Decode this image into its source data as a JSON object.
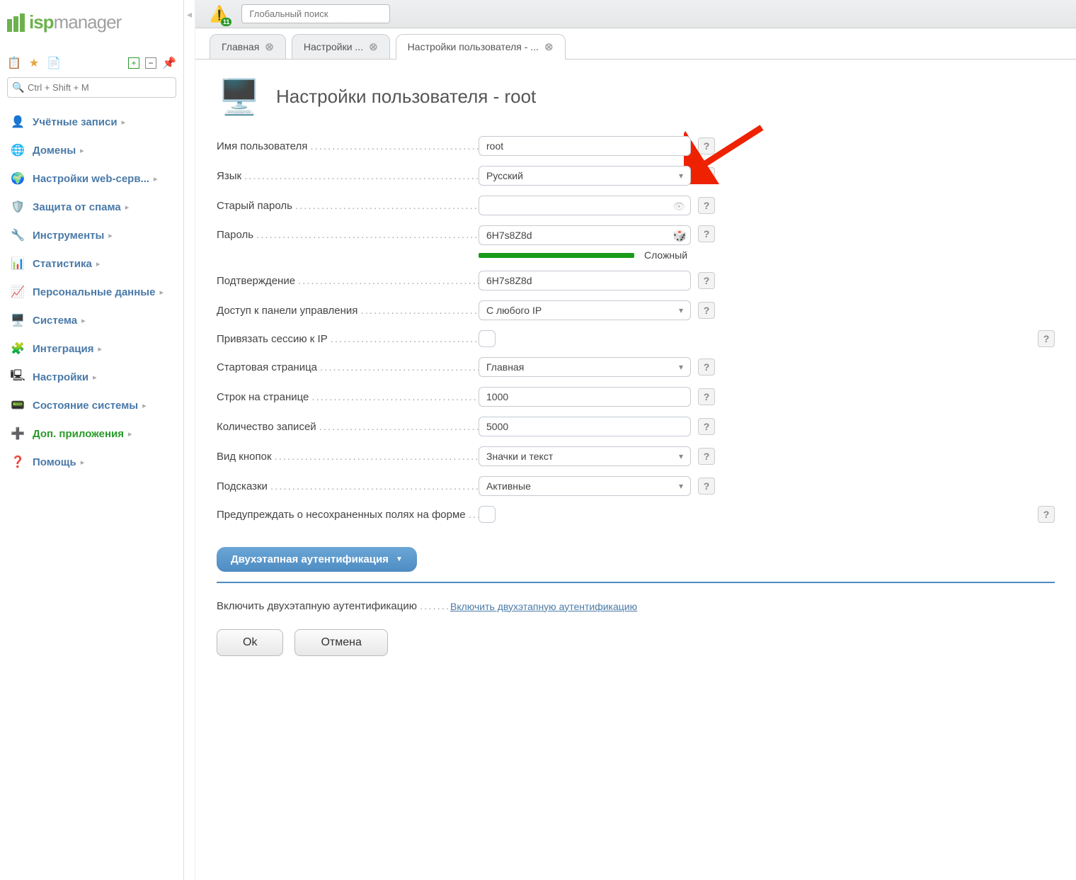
{
  "logo": {
    "prefix": "isp",
    "suffix": "manager"
  },
  "toolbar_icons": [
    "list-icon",
    "star-icon",
    "clipboard-icon",
    "plus-icon",
    "minus-icon",
    "pin-icon"
  ],
  "search": {
    "placeholder": "Ctrl + Shift + M"
  },
  "nav": [
    {
      "icon": "👤",
      "label": "Учётные записи",
      "color": "#4a7aa8"
    },
    {
      "icon": "🌐",
      "label": "Домены",
      "color": "#4a7aa8"
    },
    {
      "icon": "🌍",
      "label": "Настройки web-серв...",
      "color": "#4a7aa8"
    },
    {
      "icon": "🛡️",
      "label": "Защита от спама",
      "color": "#4a7aa8"
    },
    {
      "icon": "🔧",
      "label": "Инструменты",
      "color": "#4a7aa8"
    },
    {
      "icon": "📊",
      "label": "Статистика",
      "color": "#4a7aa8"
    },
    {
      "icon": "📈",
      "label": "Персональные данные",
      "color": "#4a7aa8"
    },
    {
      "icon": "🖥️",
      "label": "Система",
      "color": "#4a7aa8"
    },
    {
      "icon": "🧩",
      "label": "Интеграция",
      "color": "#4a7aa8"
    },
    {
      "icon": "🖳",
      "label": "Настройки",
      "color": "#4a7aa8"
    },
    {
      "icon": "📟",
      "label": "Состояние системы",
      "color": "#4a7aa8"
    },
    {
      "icon": "➕",
      "label": "Доп. приложения",
      "color": "#2a9a2a"
    },
    {
      "icon": "❓",
      "label": "Помощь",
      "color": "#4a7aa8"
    }
  ],
  "topbar": {
    "alert_count": "11",
    "global_search_placeholder": "Глобальный поиск"
  },
  "tabs": [
    {
      "label": "Главная",
      "active": false
    },
    {
      "label": "Настройки ...",
      "active": false
    },
    {
      "label": "Настройки пользователя - ...",
      "active": true
    }
  ],
  "page": {
    "title": "Настройки пользователя - root"
  },
  "form": {
    "username_label": "Имя пользователя",
    "username_value": "root",
    "language_label": "Язык",
    "language_value": "Русский",
    "old_password_label": "Старый пароль",
    "old_password_value": "",
    "password_label": "Пароль",
    "password_value": "6H7s8Z8d",
    "password_strength": "Сложный",
    "confirm_label": "Подтверждение",
    "confirm_value": "6H7s8Z8d",
    "panel_access_label": "Доступ к панели управления",
    "panel_access_value": "С любого IP",
    "bind_session_label": "Привязать сессию к IP",
    "start_page_label": "Стартовая страница",
    "start_page_value": "Главная",
    "rows_per_page_label": "Строк на странице",
    "rows_per_page_value": "1000",
    "records_count_label": "Количество записей",
    "records_count_value": "5000",
    "buttons_view_label": "Вид кнопок",
    "buttons_view_value": "Значки и текст",
    "tooltips_label": "Подсказки",
    "tooltips_value": "Активные",
    "warn_unsaved_label": "Предупреждать о несохраненных полях на форме"
  },
  "section2": {
    "title": "Двухэтапная аутентификация",
    "enable_label": "Включить двухэтапную аутентификацию",
    "enable_link": "Включить двухэтапную аутентификацию"
  },
  "buttons": {
    "ok": "Ok",
    "cancel": "Отмена"
  },
  "help_symbol": "?"
}
